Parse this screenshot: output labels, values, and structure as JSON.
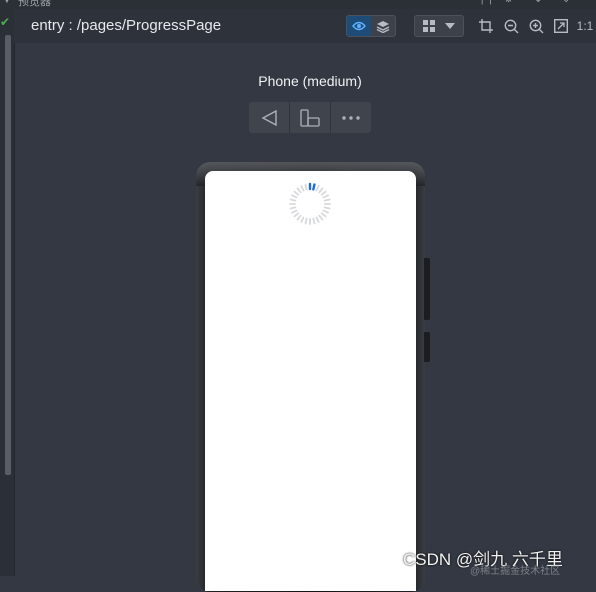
{
  "panel": {
    "title": "预览器"
  },
  "breadcrumb": "entry : /pages/ProgressPage",
  "device": {
    "name": "Phone (medium)"
  },
  "watermark": {
    "text": "CSDN @剑九 六千里",
    "subtext": "@稀土掘金技术社区"
  },
  "colors": {
    "accent": "#1e4c78",
    "spinner_head": "#1f6fd0"
  },
  "progress": {
    "type": "ring-loading"
  }
}
